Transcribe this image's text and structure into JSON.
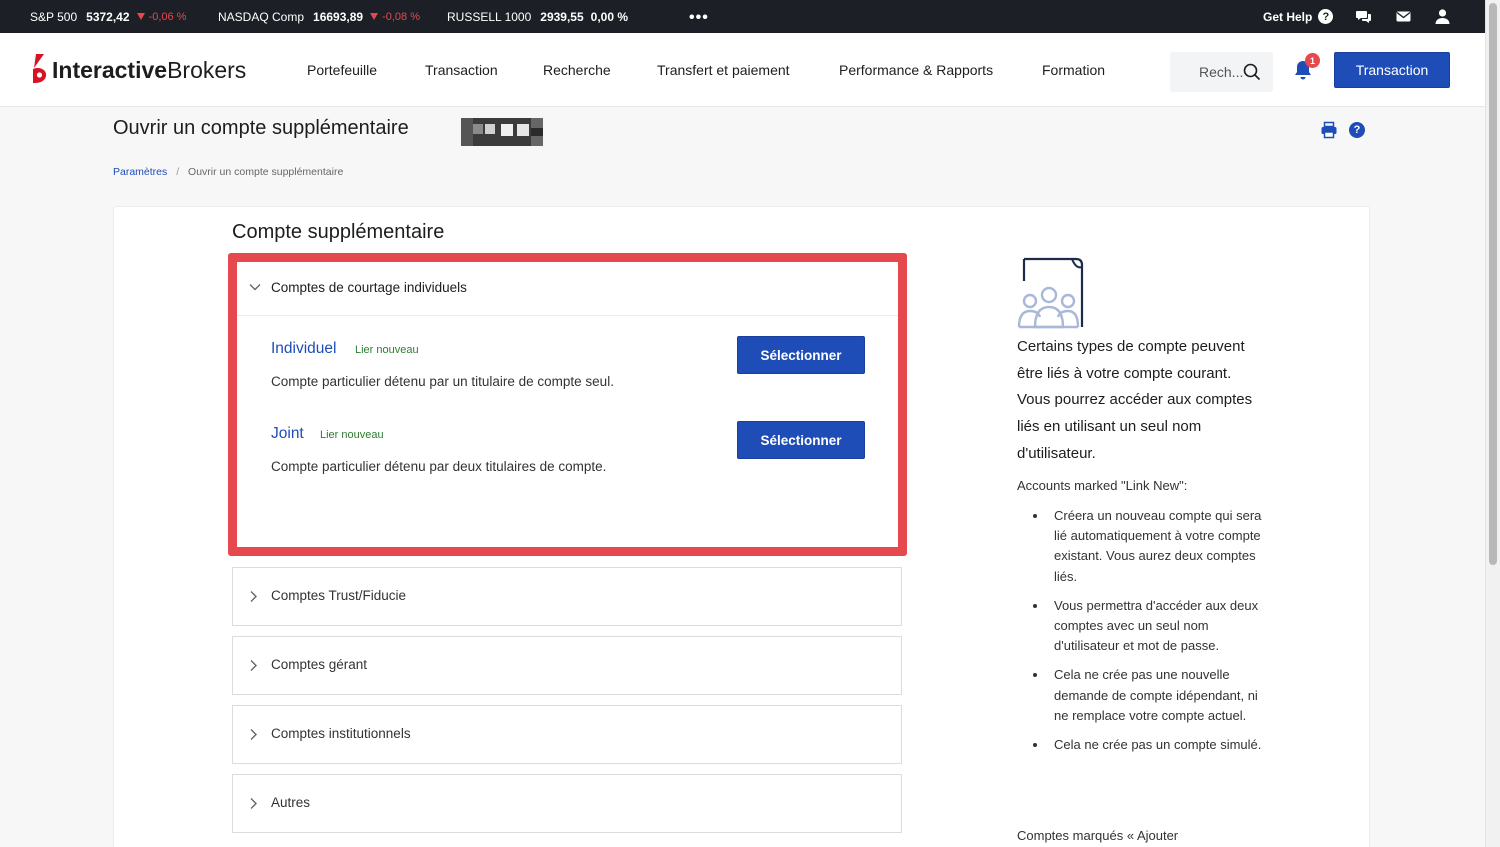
{
  "ticker": [
    {
      "name": "S&P 500",
      "value": "5372,42",
      "change": "-0,06 %",
      "direction": "down"
    },
    {
      "name": "NASDAQ Comp",
      "value": "16693,89",
      "change": "-0,08 %",
      "direction": "down"
    },
    {
      "name": "RUSSELL 1000",
      "value": "2939,55",
      "change": "0,00 %",
      "direction": "flat"
    }
  ],
  "topbar": {
    "more": "•••",
    "get_help": "Get Help",
    "help_glyph": "?"
  },
  "logo": {
    "part1": "Interactive",
    "part2": "Brokers"
  },
  "nav": {
    "items": [
      "Portefeuille",
      "Transaction",
      "Recherche",
      "Transfert et paiement",
      "Performance & Rapports",
      "Formation"
    ],
    "search_placeholder": "Rech...",
    "notification_count": "1",
    "transaction_button": "Transaction"
  },
  "page": {
    "title": "Ouvrir un compte supplémentaire",
    "help_glyph": "?",
    "breadcrumb": {
      "parent": "Paramètres",
      "separator": "/",
      "current": "Ouvrir un compte supplémentaire"
    }
  },
  "section": {
    "title": "Compte supplémentaire",
    "open_group": {
      "title": "Comptes de courtage individuels",
      "options": [
        {
          "name": "Individuel",
          "tag": "Lier nouveau",
          "description": "Compte particulier détenu par un titulaire de compte seul.",
          "button": "Sélectionner"
        },
        {
          "name": "Joint",
          "tag": "Lier nouveau",
          "description": "Compte particulier détenu par deux titulaires de compte.",
          "button": "Sélectionner"
        }
      ]
    },
    "closed_groups": [
      "Comptes Trust/Fiducie",
      "Comptes gérant",
      "Comptes institutionnels",
      "Autres"
    ]
  },
  "side": {
    "lead": "Certains types de compte peuvent être liés à votre compte courant. Vous pourrez accéder aux comptes liés en utilisant un seul nom d'utilisateur.",
    "subheading": "Accounts marked \"Link New\":",
    "bullets": [
      "Créera un nouveau compte qui sera lié automatiquement à votre compte existant. Vous aurez deux comptes liés.",
      "Vous permettra d'accéder aux deux comptes avec un seul nom d'utilisateur et mot de passe.",
      "Cela ne crée pas une nouvelle demande de compte idépendant, ni ne remplace votre compte actuel.",
      "Cela ne crée pas un compte simulé."
    ],
    "more": "Comptes marqués « Ajouter"
  },
  "colors": {
    "brand_blue": "#1e4db7",
    "alert_red": "#e5484d",
    "topbar_bg": "#1c2026",
    "link_green": "#2e7d32"
  }
}
